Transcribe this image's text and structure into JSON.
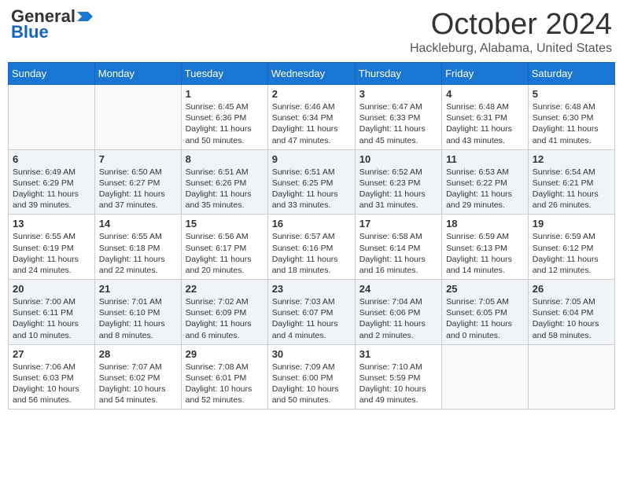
{
  "header": {
    "logo_general": "General",
    "logo_blue": "Blue",
    "month_title": "October 2024",
    "location": "Hackleburg, Alabama, United States"
  },
  "days_of_week": [
    "Sunday",
    "Monday",
    "Tuesday",
    "Wednesday",
    "Thursday",
    "Friday",
    "Saturday"
  ],
  "weeks": [
    [
      {
        "day": "",
        "info": ""
      },
      {
        "day": "",
        "info": ""
      },
      {
        "day": "1",
        "info": "Sunrise: 6:45 AM\nSunset: 6:36 PM\nDaylight: 11 hours and 50 minutes."
      },
      {
        "day": "2",
        "info": "Sunrise: 6:46 AM\nSunset: 6:34 PM\nDaylight: 11 hours and 47 minutes."
      },
      {
        "day": "3",
        "info": "Sunrise: 6:47 AM\nSunset: 6:33 PM\nDaylight: 11 hours and 45 minutes."
      },
      {
        "day": "4",
        "info": "Sunrise: 6:48 AM\nSunset: 6:31 PM\nDaylight: 11 hours and 43 minutes."
      },
      {
        "day": "5",
        "info": "Sunrise: 6:48 AM\nSunset: 6:30 PM\nDaylight: 11 hours and 41 minutes."
      }
    ],
    [
      {
        "day": "6",
        "info": "Sunrise: 6:49 AM\nSunset: 6:29 PM\nDaylight: 11 hours and 39 minutes."
      },
      {
        "day": "7",
        "info": "Sunrise: 6:50 AM\nSunset: 6:27 PM\nDaylight: 11 hours and 37 minutes."
      },
      {
        "day": "8",
        "info": "Sunrise: 6:51 AM\nSunset: 6:26 PM\nDaylight: 11 hours and 35 minutes."
      },
      {
        "day": "9",
        "info": "Sunrise: 6:51 AM\nSunset: 6:25 PM\nDaylight: 11 hours and 33 minutes."
      },
      {
        "day": "10",
        "info": "Sunrise: 6:52 AM\nSunset: 6:23 PM\nDaylight: 11 hours and 31 minutes."
      },
      {
        "day": "11",
        "info": "Sunrise: 6:53 AM\nSunset: 6:22 PM\nDaylight: 11 hours and 29 minutes."
      },
      {
        "day": "12",
        "info": "Sunrise: 6:54 AM\nSunset: 6:21 PM\nDaylight: 11 hours and 26 minutes."
      }
    ],
    [
      {
        "day": "13",
        "info": "Sunrise: 6:55 AM\nSunset: 6:19 PM\nDaylight: 11 hours and 24 minutes."
      },
      {
        "day": "14",
        "info": "Sunrise: 6:55 AM\nSunset: 6:18 PM\nDaylight: 11 hours and 22 minutes."
      },
      {
        "day": "15",
        "info": "Sunrise: 6:56 AM\nSunset: 6:17 PM\nDaylight: 11 hours and 20 minutes."
      },
      {
        "day": "16",
        "info": "Sunrise: 6:57 AM\nSunset: 6:16 PM\nDaylight: 11 hours and 18 minutes."
      },
      {
        "day": "17",
        "info": "Sunrise: 6:58 AM\nSunset: 6:14 PM\nDaylight: 11 hours and 16 minutes."
      },
      {
        "day": "18",
        "info": "Sunrise: 6:59 AM\nSunset: 6:13 PM\nDaylight: 11 hours and 14 minutes."
      },
      {
        "day": "19",
        "info": "Sunrise: 6:59 AM\nSunset: 6:12 PM\nDaylight: 11 hours and 12 minutes."
      }
    ],
    [
      {
        "day": "20",
        "info": "Sunrise: 7:00 AM\nSunset: 6:11 PM\nDaylight: 11 hours and 10 minutes."
      },
      {
        "day": "21",
        "info": "Sunrise: 7:01 AM\nSunset: 6:10 PM\nDaylight: 11 hours and 8 minutes."
      },
      {
        "day": "22",
        "info": "Sunrise: 7:02 AM\nSunset: 6:09 PM\nDaylight: 11 hours and 6 minutes."
      },
      {
        "day": "23",
        "info": "Sunrise: 7:03 AM\nSunset: 6:07 PM\nDaylight: 11 hours and 4 minutes."
      },
      {
        "day": "24",
        "info": "Sunrise: 7:04 AM\nSunset: 6:06 PM\nDaylight: 11 hours and 2 minutes."
      },
      {
        "day": "25",
        "info": "Sunrise: 7:05 AM\nSunset: 6:05 PM\nDaylight: 11 hours and 0 minutes."
      },
      {
        "day": "26",
        "info": "Sunrise: 7:05 AM\nSunset: 6:04 PM\nDaylight: 10 hours and 58 minutes."
      }
    ],
    [
      {
        "day": "27",
        "info": "Sunrise: 7:06 AM\nSunset: 6:03 PM\nDaylight: 10 hours and 56 minutes."
      },
      {
        "day": "28",
        "info": "Sunrise: 7:07 AM\nSunset: 6:02 PM\nDaylight: 10 hours and 54 minutes."
      },
      {
        "day": "29",
        "info": "Sunrise: 7:08 AM\nSunset: 6:01 PM\nDaylight: 10 hours and 52 minutes."
      },
      {
        "day": "30",
        "info": "Sunrise: 7:09 AM\nSunset: 6:00 PM\nDaylight: 10 hours and 50 minutes."
      },
      {
        "day": "31",
        "info": "Sunrise: 7:10 AM\nSunset: 5:59 PM\nDaylight: 10 hours and 49 minutes."
      },
      {
        "day": "",
        "info": ""
      },
      {
        "day": "",
        "info": ""
      }
    ]
  ]
}
